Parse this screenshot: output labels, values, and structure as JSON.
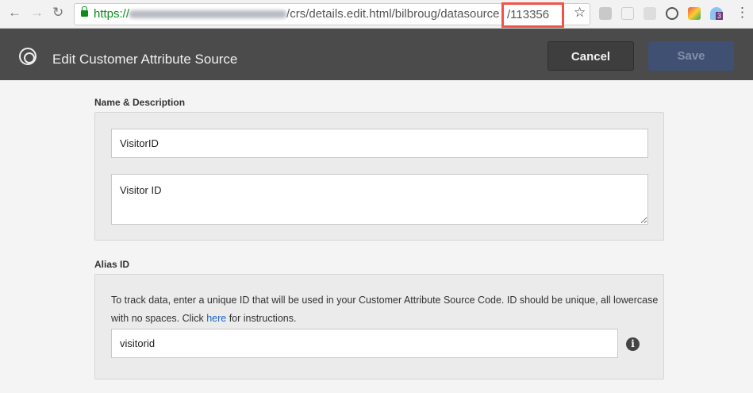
{
  "browser": {
    "url_scheme": "https://",
    "url_path": "/crs/details.edit.html/bilbroug/datasource",
    "url_highlight": "/113356",
    "extension_badge": "3",
    "icons": [
      "back-arrow-icon",
      "forward-arrow-icon",
      "reload-icon",
      "lock-icon",
      "star-icon",
      "menu-dots-icon"
    ]
  },
  "header": {
    "title": "Edit Customer Attribute Source",
    "cancel_label": "Cancel",
    "save_label": "Save"
  },
  "name_section": {
    "label": "Name & Description",
    "name_value": "VisitorID",
    "description_value": "Visitor ID"
  },
  "alias_section": {
    "label": "Alias ID",
    "help_before": "To track data, enter a unique ID that will be used in your Customer Attribute Source Code. ID should be unique, all lowercase with no spaces. Click ",
    "help_link": "here",
    "help_after": " for instructions.",
    "alias_value": "visitorid",
    "info_icon": "i"
  },
  "colors": {
    "header_bg": "#4b4b4b",
    "save_bg": "#3f5073",
    "highlight_box": "#f0534a",
    "link": "#2166c6"
  }
}
